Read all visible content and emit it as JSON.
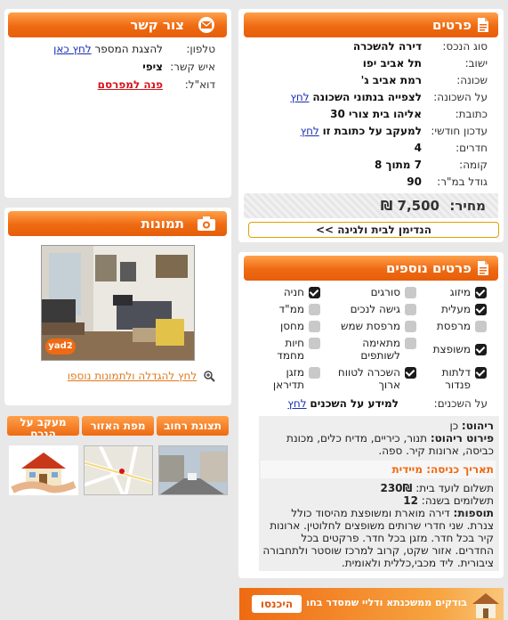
{
  "details": {
    "title": "פרטים",
    "rows": [
      {
        "label": "סוג הנכס:",
        "value": "דירה להשכרה"
      },
      {
        "label": "ישוב:",
        "value": "תל אביב יפו"
      },
      {
        "label": "שכונה:",
        "value": "רמת אביב ג'"
      },
      {
        "label": "על השכונה:",
        "value": "לצפייה בנתוני השכונה",
        "link": "לחץ"
      },
      {
        "label": "כתובת:",
        "value": "אליהו בית צורי 30"
      },
      {
        "label": "עדכון חודשי:",
        "value": "למעקב על כתובת זו",
        "link": "לחץ"
      },
      {
        "label": "חדרים:",
        "value": "4"
      },
      {
        "label": "קומה:",
        "value": "7 מתוך 8"
      },
      {
        "label": "גודל במ\"ר:",
        "value": "90"
      }
    ],
    "price_label": "מחיר:",
    "price_value": "7,500 ₪",
    "button": "הנדימן לבית ולגינה >>"
  },
  "contact": {
    "title": "צור קשר",
    "phone_label": "טלפון:",
    "phone_text": "להצגת המספר",
    "phone_link": "לחץ כאן",
    "person_label": "איש קשר:",
    "person_value": "ציפי",
    "email_label": "דוא\"ל:",
    "email_link": "פנה למפרסם"
  },
  "photos": {
    "title": "תמונות",
    "watermark": "yad2",
    "enlarge_link": "לחץ להגדלה ולתמונות נוספו"
  },
  "tabs": [
    {
      "label": "תצוגת רחוב"
    },
    {
      "label": "מפת האזור"
    },
    {
      "label": "מעקב על הנכס"
    }
  ],
  "extra": {
    "title": "פרטים נוספים",
    "features": [
      {
        "label": "מיזוג",
        "checked": true
      },
      {
        "label": "סורגים",
        "checked": false
      },
      {
        "label": "חניה",
        "checked": true
      },
      {
        "label": "מעלית",
        "checked": true
      },
      {
        "label": "גישה לנכים",
        "checked": false
      },
      {
        "label": "ממ\"ד",
        "checked": false
      },
      {
        "label": "מרפסת",
        "checked": false
      },
      {
        "label": "מרפסת שמש",
        "checked": false
      },
      {
        "label": "מחסן",
        "checked": false
      },
      {
        "label": "משופצת",
        "checked": true
      },
      {
        "label": "מתאימה לשותפים",
        "checked": false
      },
      {
        "label": "חיות מחמד",
        "checked": false
      },
      {
        "label": "דלתות פנדור",
        "checked": true
      },
      {
        "label": "השכרה לטווח ארוך",
        "checked": true
      },
      {
        "label": "מזגן תדיראן",
        "checked": false
      }
    ],
    "neighbors_label": "על השכנים:",
    "neighbors_text": "למידע על השכנים",
    "neighbors_link": "לחץ",
    "furniture_label": "ריהוט:",
    "furniture_value": "כן",
    "furniture_detail_label": "פירוט ריהוט:",
    "furniture_detail_value": "תנור, כיריים, מדיח כלים, מכונת כביסה, ארונות קיר. ספה.",
    "entry_label": "תאריך כניסה:",
    "entry_value": "מיידית",
    "payments_label": "תשלום לועד בית:",
    "payments_value": "230₪",
    "payments_per_year_label": "תשלומים בשנה:",
    "payments_per_year_value": "12",
    "additions_label": "תוספות:",
    "additions_value": "דירה מוארת ומשופצת מהיסוד כולל צנרת. שני חדרי שרותים משופצים לחלוטין. ארונות קיר בכל חדר. מזגן בכל חדר. פרקטים בכל החדרים. אזור שקט, קרוב למרכז שוסטר ולתחבורה ציבורית. ליד מכבי,כללית ולאומית."
  },
  "banner": {
    "main": "בודקים ממשכנתא ודליי שמסדר בחמשכנתא",
    "cta": "היכנסו"
  },
  "colors": {
    "accent": "#ef6a12",
    "link": "#1a2fb3",
    "red": "#d8121a"
  }
}
